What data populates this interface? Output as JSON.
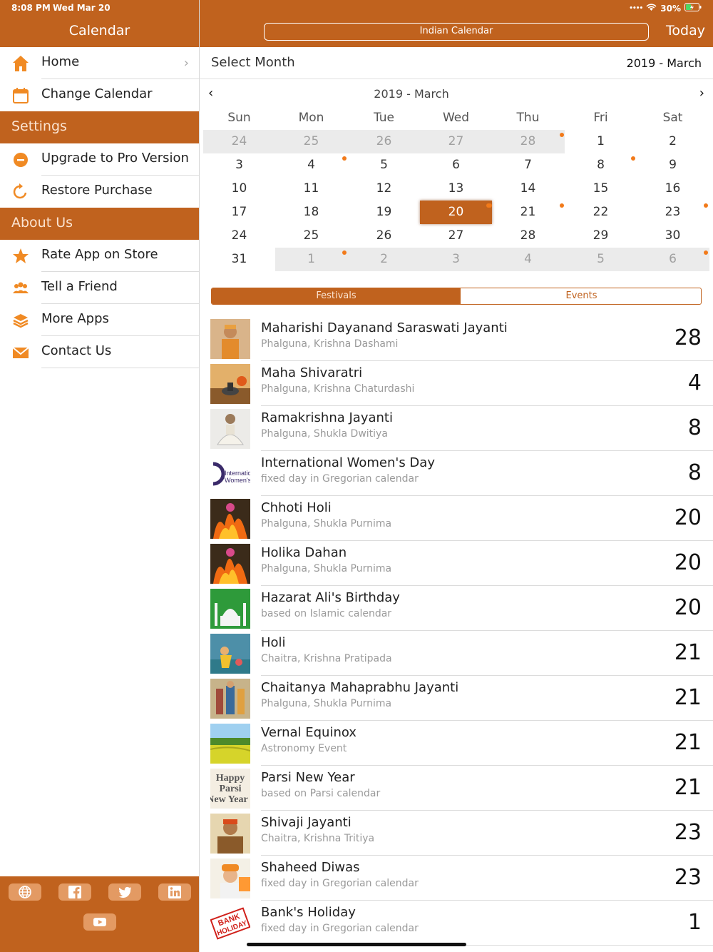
{
  "status": {
    "time": "8:08 PM",
    "date": "Wed Mar 20",
    "battery": "30%"
  },
  "sidebar": {
    "title": "Calendar",
    "items": [
      {
        "label": "Home"
      },
      {
        "label": "Change Calendar"
      }
    ],
    "settings_header": "Settings",
    "settings_items": [
      {
        "label": "Upgrade to Pro Version"
      },
      {
        "label": "Restore Purchase"
      }
    ],
    "about_header": "About Us",
    "about_items": [
      {
        "label": "Rate App on Store"
      },
      {
        "label": "Tell a Friend"
      },
      {
        "label": "More Apps"
      },
      {
        "label": "Contact Us"
      }
    ],
    "footer_icons": [
      "globe-icon",
      "facebook-icon",
      "twitter-icon",
      "linkedin-icon",
      "youtube-icon"
    ]
  },
  "header": {
    "calendar_type": "Indian Calendar",
    "today_label": "Today"
  },
  "month_select": {
    "label": "Select Month",
    "value": "2019 - March"
  },
  "calendar": {
    "title": "2019 - March",
    "weekdays": [
      "Sun",
      "Mon",
      "Tue",
      "Wed",
      "Thu",
      "Fri",
      "Sat"
    ],
    "weeks": [
      [
        "24",
        "25",
        "26",
        "27",
        "28",
        "1",
        "2"
      ],
      [
        "3",
        "4",
        "5",
        "6",
        "7",
        "8",
        "9"
      ],
      [
        "10",
        "11",
        "12",
        "13",
        "14",
        "15",
        "16"
      ],
      [
        "17",
        "18",
        "19",
        "20",
        "21",
        "22",
        "23"
      ],
      [
        "24",
        "25",
        "26",
        "27",
        "28",
        "29",
        "30"
      ],
      [
        "31",
        "1",
        "2",
        "3",
        "4",
        "5",
        "6"
      ]
    ],
    "selected": "20"
  },
  "tabs": {
    "festivals": "Festivals",
    "events": "Events"
  },
  "festivals": [
    {
      "name": "Maharishi Dayanand Saraswati Jayanti",
      "sub": "Phalguna, Krishna Dashami",
      "day": "28"
    },
    {
      "name": "Maha Shivaratri",
      "sub": "Phalguna, Krishna Chaturdashi",
      "day": "4"
    },
    {
      "name": "Ramakrishna Jayanti",
      "sub": "Phalguna, Shukla Dwitiya",
      "day": "8"
    },
    {
      "name": "International Women's Day",
      "sub": "fixed day in Gregorian calendar",
      "day": "8",
      "thumb_text": [
        "Internatio",
        "Women's D"
      ]
    },
    {
      "name": "Chhoti Holi",
      "sub": "Phalguna, Shukla Purnima",
      "day": "20"
    },
    {
      "name": "Holika Dahan",
      "sub": "Phalguna, Shukla Purnima",
      "day": "20"
    },
    {
      "name": "Hazarat Ali's Birthday",
      "sub": "based on Islamic calendar",
      "day": "20"
    },
    {
      "name": "Holi",
      "sub": "Chaitra, Krishna Pratipada",
      "day": "21"
    },
    {
      "name": "Chaitanya Mahaprabhu Jayanti",
      "sub": "Phalguna, Shukla Purnima",
      "day": "21"
    },
    {
      "name": "Vernal Equinox",
      "sub": "Astronomy Event",
      "day": "21"
    },
    {
      "name": "Parsi New Year",
      "sub": "based on Parsi calendar",
      "day": "21",
      "thumb_text": [
        "Happy",
        "Parsi",
        "New Year"
      ]
    },
    {
      "name": "Shivaji Jayanti",
      "sub": "Chaitra, Krishna Tritiya",
      "day": "23"
    },
    {
      "name": "Shaheed Diwas",
      "sub": "fixed day in Gregorian calendar",
      "day": "23"
    },
    {
      "name": "Bank's Holiday",
      "sub": "fixed day in Gregorian calendar",
      "day": "1",
      "thumb_text": [
        "BANK",
        "HOLIDAY"
      ]
    }
  ],
  "colors": {
    "accent": "#c0621e",
    "dot": "#f27a1a"
  }
}
